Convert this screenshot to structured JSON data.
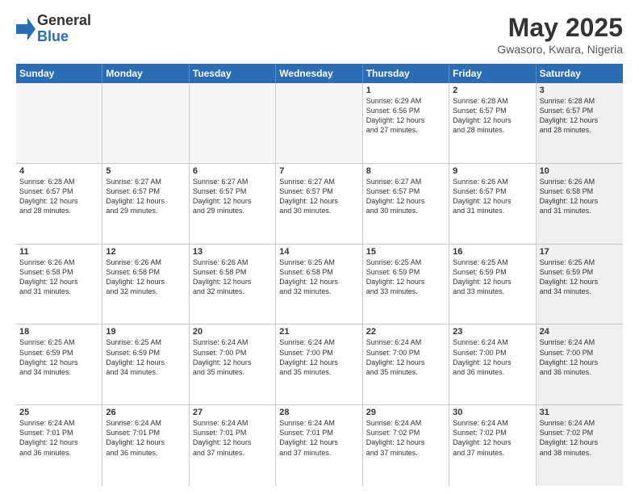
{
  "logo": {
    "general": "General",
    "blue": "Blue"
  },
  "title": "May 2025",
  "location": "Gwasoro, Kwara, Nigeria",
  "header_days": [
    "Sunday",
    "Monday",
    "Tuesday",
    "Wednesday",
    "Thursday",
    "Friday",
    "Saturday"
  ],
  "weeks": [
    [
      {
        "day": "",
        "content": "",
        "empty": true
      },
      {
        "day": "",
        "content": "",
        "empty": true
      },
      {
        "day": "",
        "content": "",
        "empty": true
      },
      {
        "day": "",
        "content": "",
        "empty": true
      },
      {
        "day": "1",
        "content": "Sunrise: 6:29 AM\nSunset: 6:56 PM\nDaylight: 12 hours\nand 27 minutes.",
        "empty": false
      },
      {
        "day": "2",
        "content": "Sunrise: 6:28 AM\nSunset: 6:57 PM\nDaylight: 12 hours\nand 28 minutes.",
        "empty": false
      },
      {
        "day": "3",
        "content": "Sunrise: 6:28 AM\nSunset: 6:57 PM\nDaylight: 12 hours\nand 28 minutes.",
        "empty": false,
        "shaded": true
      }
    ],
    [
      {
        "day": "4",
        "content": "Sunrise: 6:28 AM\nSunset: 6:57 PM\nDaylight: 12 hours\nand 28 minutes.",
        "empty": false
      },
      {
        "day": "5",
        "content": "Sunrise: 6:27 AM\nSunset: 6:57 PM\nDaylight: 12 hours\nand 29 minutes.",
        "empty": false
      },
      {
        "day": "6",
        "content": "Sunrise: 6:27 AM\nSunset: 6:57 PM\nDaylight: 12 hours\nand 29 minutes.",
        "empty": false
      },
      {
        "day": "7",
        "content": "Sunrise: 6:27 AM\nSunset: 6:57 PM\nDaylight: 12 hours\nand 30 minutes.",
        "empty": false
      },
      {
        "day": "8",
        "content": "Sunrise: 6:27 AM\nSunset: 6:57 PM\nDaylight: 12 hours\nand 30 minutes.",
        "empty": false
      },
      {
        "day": "9",
        "content": "Sunrise: 6:26 AM\nSunset: 6:57 PM\nDaylight: 12 hours\nand 31 minutes.",
        "empty": false
      },
      {
        "day": "10",
        "content": "Sunrise: 6:26 AM\nSunset: 6:58 PM\nDaylight: 12 hours\nand 31 minutes.",
        "empty": false,
        "shaded": true
      }
    ],
    [
      {
        "day": "11",
        "content": "Sunrise: 6:26 AM\nSunset: 6:58 PM\nDaylight: 12 hours\nand 31 minutes.",
        "empty": false
      },
      {
        "day": "12",
        "content": "Sunrise: 6:26 AM\nSunset: 6:58 PM\nDaylight: 12 hours\nand 32 minutes.",
        "empty": false
      },
      {
        "day": "13",
        "content": "Sunrise: 6:26 AM\nSunset: 6:58 PM\nDaylight: 12 hours\nand 32 minutes.",
        "empty": false
      },
      {
        "day": "14",
        "content": "Sunrise: 6:25 AM\nSunset: 6:58 PM\nDaylight: 12 hours\nand 32 minutes.",
        "empty": false
      },
      {
        "day": "15",
        "content": "Sunrise: 6:25 AM\nSunset: 6:59 PM\nDaylight: 12 hours\nand 33 minutes.",
        "empty": false
      },
      {
        "day": "16",
        "content": "Sunrise: 6:25 AM\nSunset: 6:59 PM\nDaylight: 12 hours\nand 33 minutes.",
        "empty": false
      },
      {
        "day": "17",
        "content": "Sunrise: 6:25 AM\nSunset: 6:59 PM\nDaylight: 12 hours\nand 34 minutes.",
        "empty": false,
        "shaded": true
      }
    ],
    [
      {
        "day": "18",
        "content": "Sunrise: 6:25 AM\nSunset: 6:59 PM\nDaylight: 12 hours\nand 34 minutes.",
        "empty": false
      },
      {
        "day": "19",
        "content": "Sunrise: 6:25 AM\nSunset: 6:59 PM\nDaylight: 12 hours\nand 34 minutes.",
        "empty": false
      },
      {
        "day": "20",
        "content": "Sunrise: 6:24 AM\nSunset: 7:00 PM\nDaylight: 12 hours\nand 35 minutes.",
        "empty": false
      },
      {
        "day": "21",
        "content": "Sunrise: 6:24 AM\nSunset: 7:00 PM\nDaylight: 12 hours\nand 35 minutes.",
        "empty": false
      },
      {
        "day": "22",
        "content": "Sunrise: 6:24 AM\nSunset: 7:00 PM\nDaylight: 12 hours\nand 35 minutes.",
        "empty": false
      },
      {
        "day": "23",
        "content": "Sunrise: 6:24 AM\nSunset: 7:00 PM\nDaylight: 12 hours\nand 36 minutes.",
        "empty": false
      },
      {
        "day": "24",
        "content": "Sunrise: 6:24 AM\nSunset: 7:00 PM\nDaylight: 12 hours\nand 36 minutes.",
        "empty": false,
        "shaded": true
      }
    ],
    [
      {
        "day": "25",
        "content": "Sunrise: 6:24 AM\nSunset: 7:01 PM\nDaylight: 12 hours\nand 36 minutes.",
        "empty": false
      },
      {
        "day": "26",
        "content": "Sunrise: 6:24 AM\nSunset: 7:01 PM\nDaylight: 12 hours\nand 36 minutes.",
        "empty": false
      },
      {
        "day": "27",
        "content": "Sunrise: 6:24 AM\nSunset: 7:01 PM\nDaylight: 12 hours\nand 37 minutes.",
        "empty": false
      },
      {
        "day": "28",
        "content": "Sunrise: 6:24 AM\nSunset: 7:01 PM\nDaylight: 12 hours\nand 37 minutes.",
        "empty": false
      },
      {
        "day": "29",
        "content": "Sunrise: 6:24 AM\nSunset: 7:02 PM\nDaylight: 12 hours\nand 37 minutes.",
        "empty": false
      },
      {
        "day": "30",
        "content": "Sunrise: 6:24 AM\nSunset: 7:02 PM\nDaylight: 12 hours\nand 37 minutes.",
        "empty": false
      },
      {
        "day": "31",
        "content": "Sunrise: 6:24 AM\nSunset: 7:02 PM\nDaylight: 12 hours\nand 38 minutes.",
        "empty": false,
        "shaded": true
      }
    ]
  ]
}
